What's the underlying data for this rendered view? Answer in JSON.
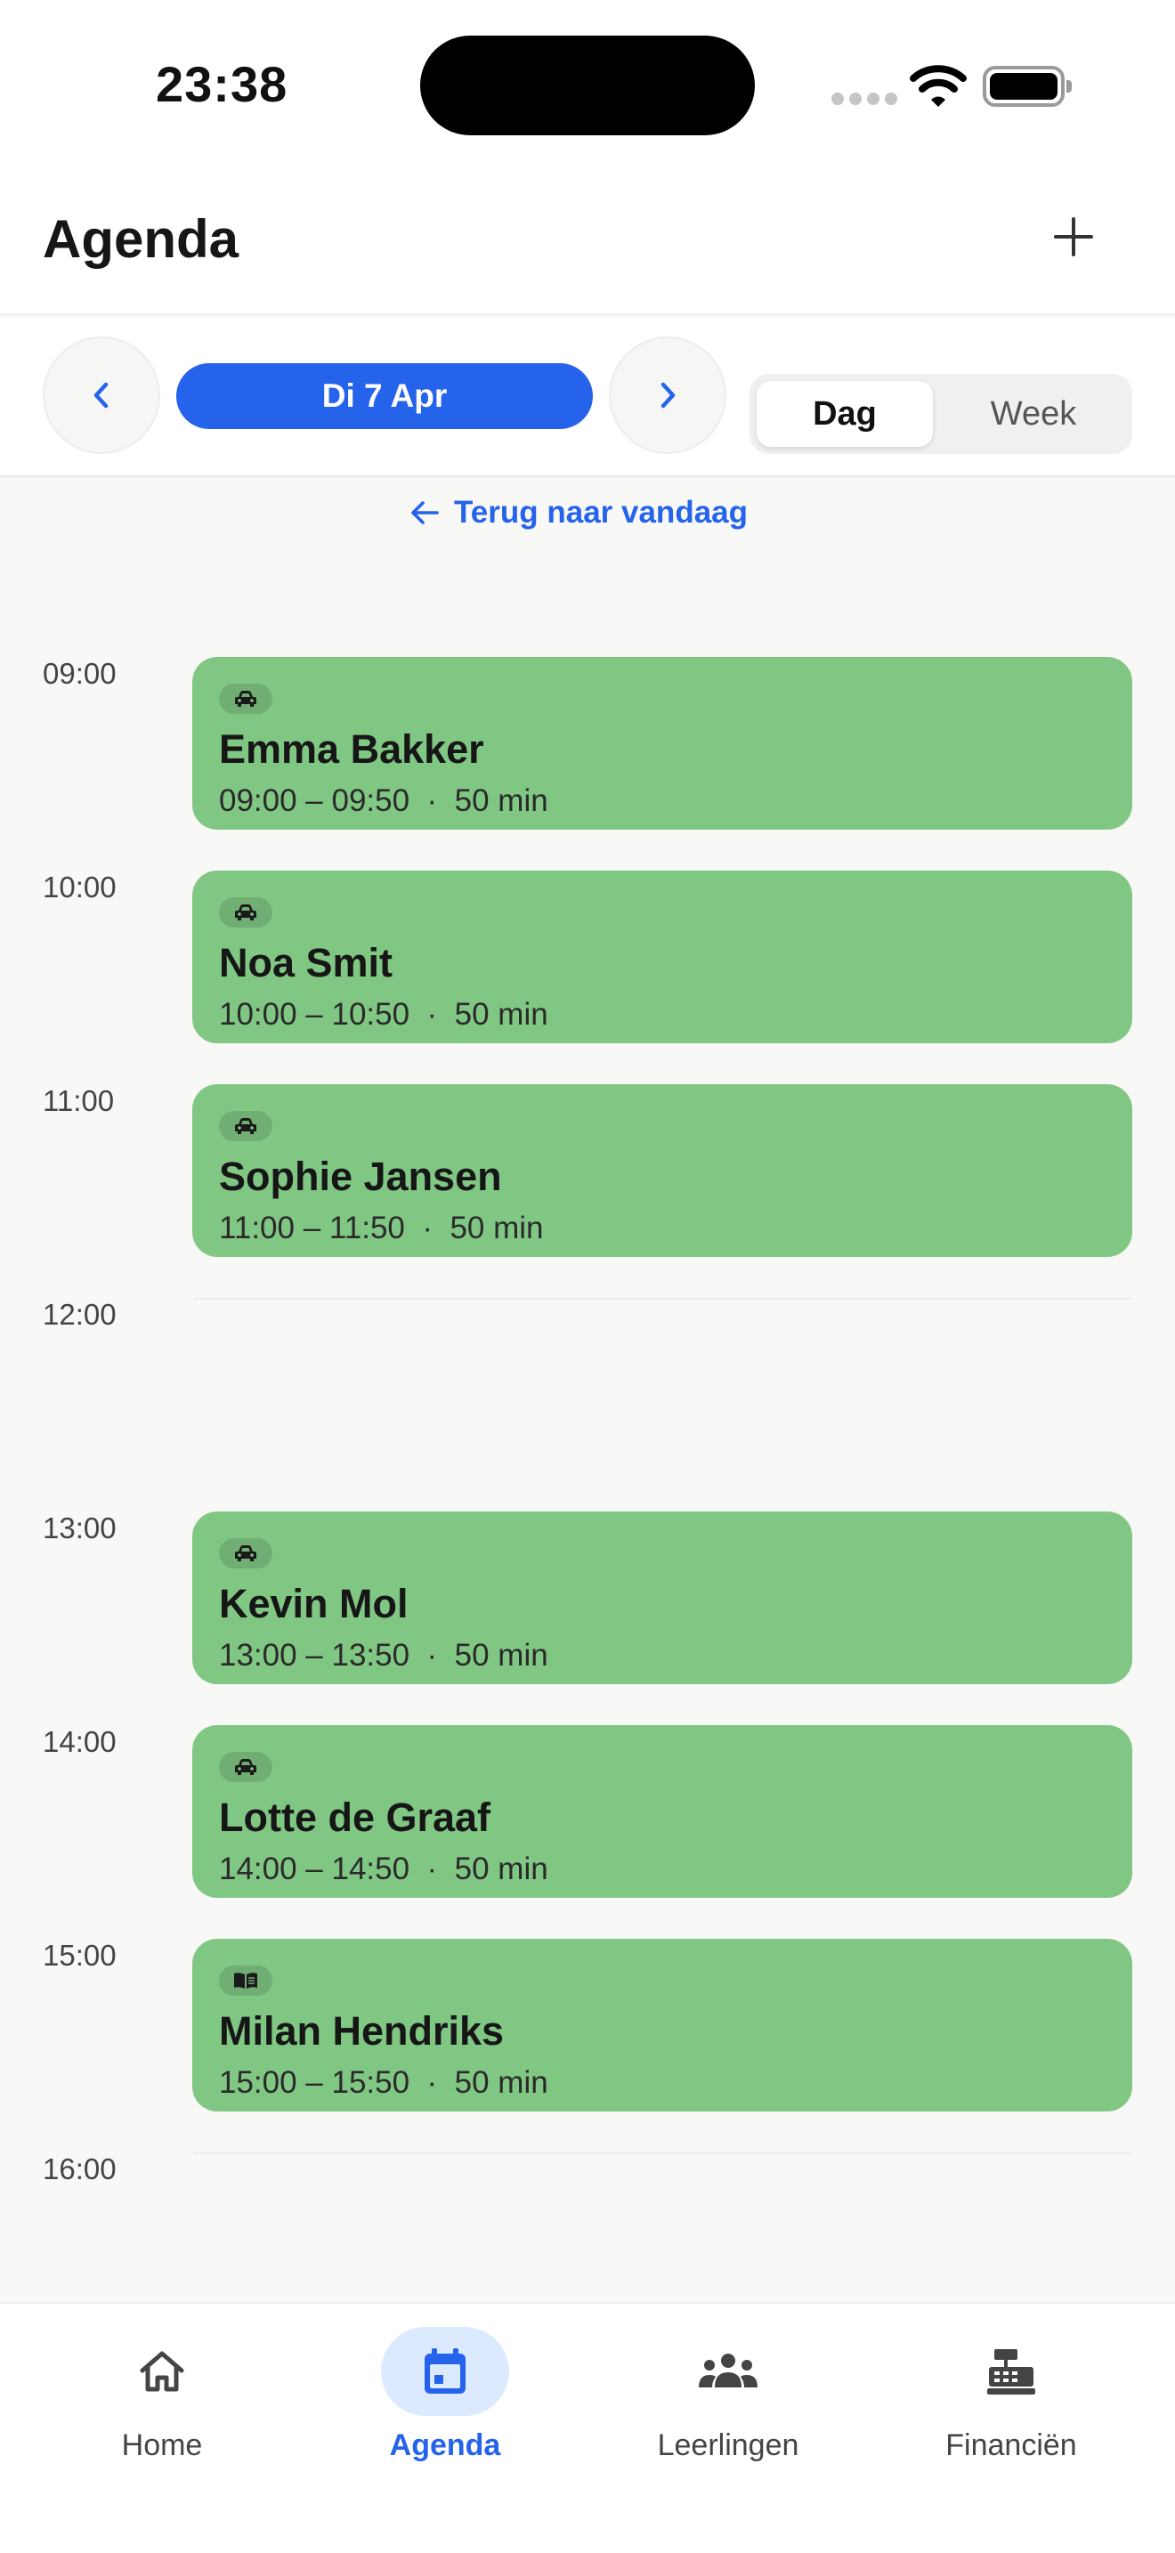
{
  "status_bar": {
    "time": "23:38"
  },
  "header": {
    "title": "Agenda",
    "add_icon": "plus-icon"
  },
  "toolbar": {
    "prev_icon": "chevron-left-icon",
    "next_icon": "chevron-right-icon",
    "date_label": "Di 7 Apr",
    "view_options": [
      "Dag",
      "Week"
    ],
    "selected_view": "Dag"
  },
  "back_to_today": "Terug naar vandaag",
  "hours": [
    "09:00",
    "10:00",
    "11:00",
    "12:00",
    "13:00",
    "14:00",
    "15:00",
    "16:00"
  ],
  "lessons": [
    {
      "type_icon": "car-icon",
      "name": "Emma Bakker",
      "meta": "09:00 – 09:50  ·  50 min"
    },
    {
      "type_icon": "car-icon",
      "name": "Noa Smit",
      "meta": "10:00 – 10:50  ·  50 min"
    },
    {
      "type_icon": "car-icon",
      "name": "Sophie Jansen",
      "meta": "11:00 – 11:50  ·  50 min"
    },
    {
      "type_icon": "car-icon",
      "name": "Kevin Mol",
      "meta": "13:00 – 13:50  ·  50 min"
    },
    {
      "type_icon": "car-icon",
      "name": "Lotte de Graaf",
      "meta": "14:00 – 14:50  ·  50 min"
    },
    {
      "type_icon": "book-icon",
      "name": "Milan Hendriks",
      "meta": "15:00 – 15:50  ·  50 min"
    }
  ],
  "colors": {
    "accent": "#2563eb",
    "lesson_bg": "#81c784",
    "active_tab_bg": "#dbeafe"
  },
  "bottom_nav": {
    "items": [
      {
        "label": "Home",
        "icon": "home-icon"
      },
      {
        "label": "Agenda",
        "icon": "calendar-icon"
      },
      {
        "label": "Leerlingen",
        "icon": "people-icon"
      },
      {
        "label": "Financiën",
        "icon": "cash-register-icon"
      }
    ],
    "active": "Agenda"
  }
}
